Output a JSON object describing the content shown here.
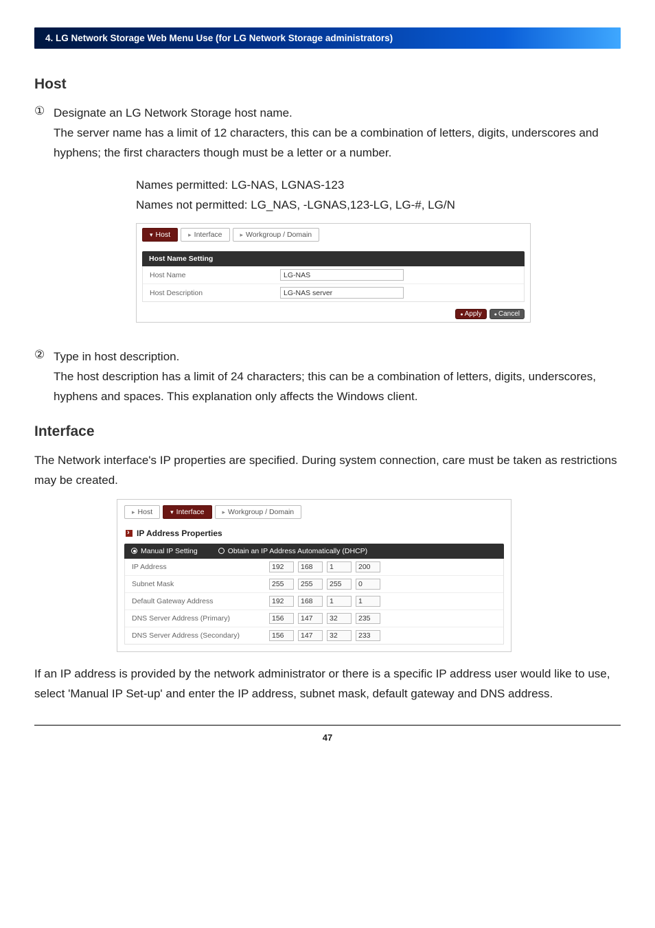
{
  "header": {
    "title": "4. LG Network Storage Web Menu Use (for LG Network Storage administrators)"
  },
  "host_section": {
    "title": "Host",
    "items": [
      {
        "num": "①",
        "lead": "Designate an LG Network Storage host name.",
        "para": "The server name has a limit of 12 characters, this can be a combination of letters, digits, underscores and hyphens; the first characters though must be a letter or a number.",
        "permitted": "Names permitted: LG-NAS, LGNAS-123",
        "not_permitted": "Names not permitted: LG_NAS, -LGNAS,123-LG, LG-#, LG/N"
      },
      {
        "num": "②",
        "lead": "Type in host description.",
        "para": "The host description has a limit of 24 characters; this can be a combination of letters, digits, underscores, hyphens and spaces. This explanation only affects the Windows client."
      }
    ]
  },
  "host_ui": {
    "tabs": {
      "host": "Host",
      "interface": "Interface",
      "workgroup": "Workgroup / Domain"
    },
    "panel_title": "Host Name Setting",
    "rows": {
      "name_label": "Host Name",
      "name_value": "LG-NAS",
      "desc_label": "Host Description",
      "desc_value": "LG-NAS server"
    },
    "buttons": {
      "apply": "Apply",
      "cancel": "Cancel"
    }
  },
  "interface_section": {
    "title": "Interface",
    "intro": "The Network interface's IP properties are specified. During system connection, care must be taken as restrictions may be created."
  },
  "iface_ui": {
    "tabs": {
      "host": "Host",
      "interface": "Interface",
      "workgroup": "Workgroup / Domain"
    },
    "props_title": "IP Address Properties",
    "options": {
      "manual": "Manual IP Setting",
      "dhcp": "Obtain an IP Address Automatically (DHCP)"
    },
    "rows": [
      {
        "label": "IP Address",
        "oct": [
          "192",
          "168",
          "1",
          "200"
        ]
      },
      {
        "label": "Subnet Mask",
        "oct": [
          "255",
          "255",
          "255",
          "0"
        ]
      },
      {
        "label": "Default Gateway Address",
        "oct": [
          "192",
          "168",
          "1",
          "1"
        ]
      },
      {
        "label": "DNS Server Address (Primary)",
        "oct": [
          "156",
          "147",
          "32",
          "235"
        ]
      },
      {
        "label": "DNS Server Address (Secondary)",
        "oct": [
          "156",
          "147",
          "32",
          "233"
        ]
      }
    ]
  },
  "closing_para": "If an IP address is provided by the network administrator or there is a specific IP address user would like to use, select 'Manual IP Set-up' and enter the IP address, subnet mask, default gateway and DNS address.",
  "page_number": "47"
}
